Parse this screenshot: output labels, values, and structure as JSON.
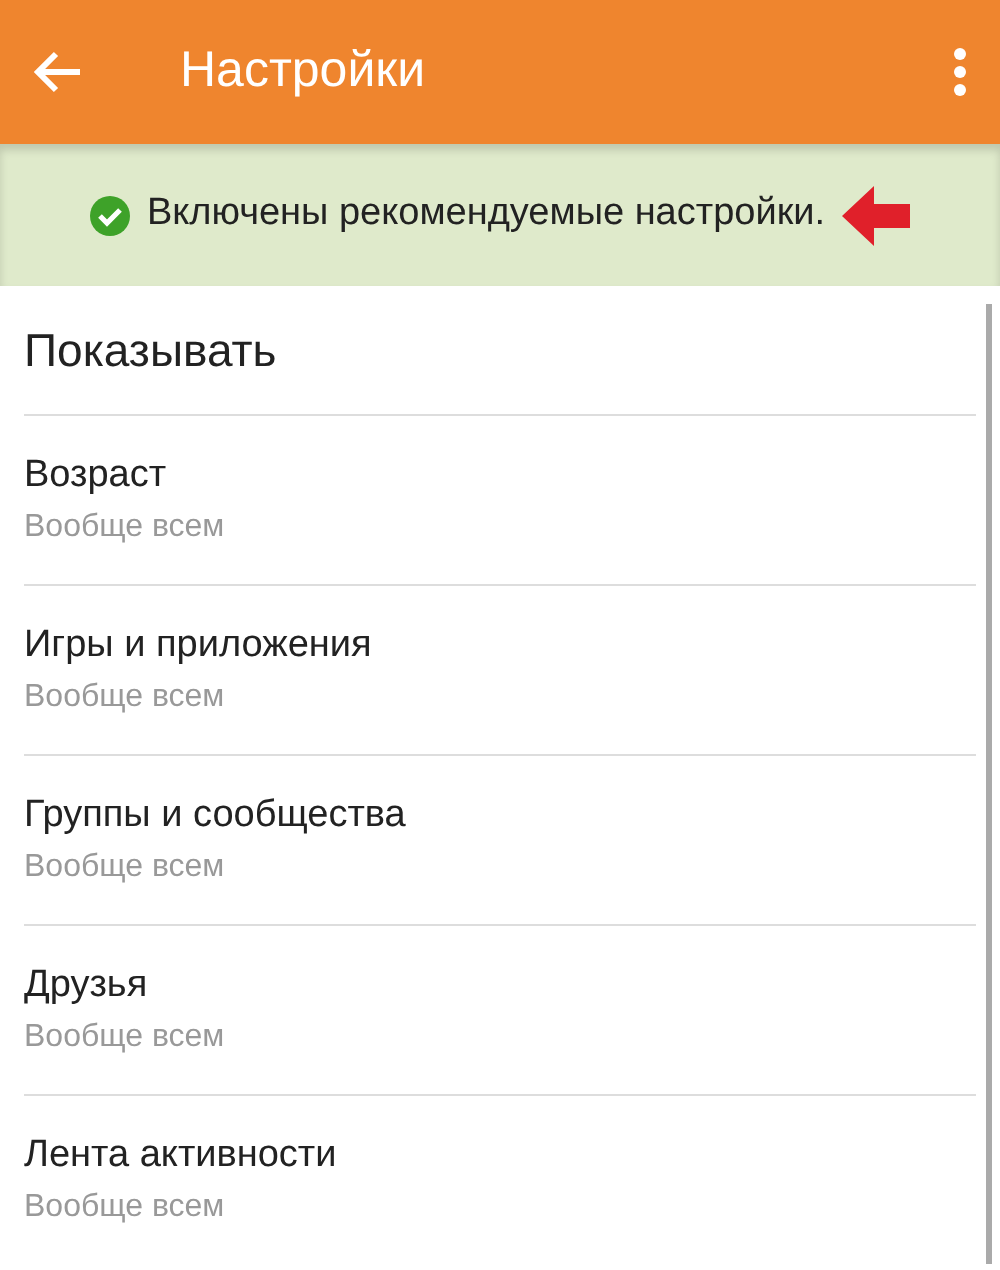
{
  "toolbar": {
    "title": "Настройки"
  },
  "banner": {
    "text": "Включены рекомендуемые настройки."
  },
  "section": {
    "title": "Показывать"
  },
  "items": [
    {
      "title": "Возраст",
      "value": "Вообще всем"
    },
    {
      "title": "Игры и приложения",
      "value": "Вообще всем"
    },
    {
      "title": "Группы и сообщества",
      "value": "Вообще всем"
    },
    {
      "title": "Друзья",
      "value": "Вообще всем"
    },
    {
      "title": "Лента активности",
      "value": "Вообще всем"
    }
  ]
}
